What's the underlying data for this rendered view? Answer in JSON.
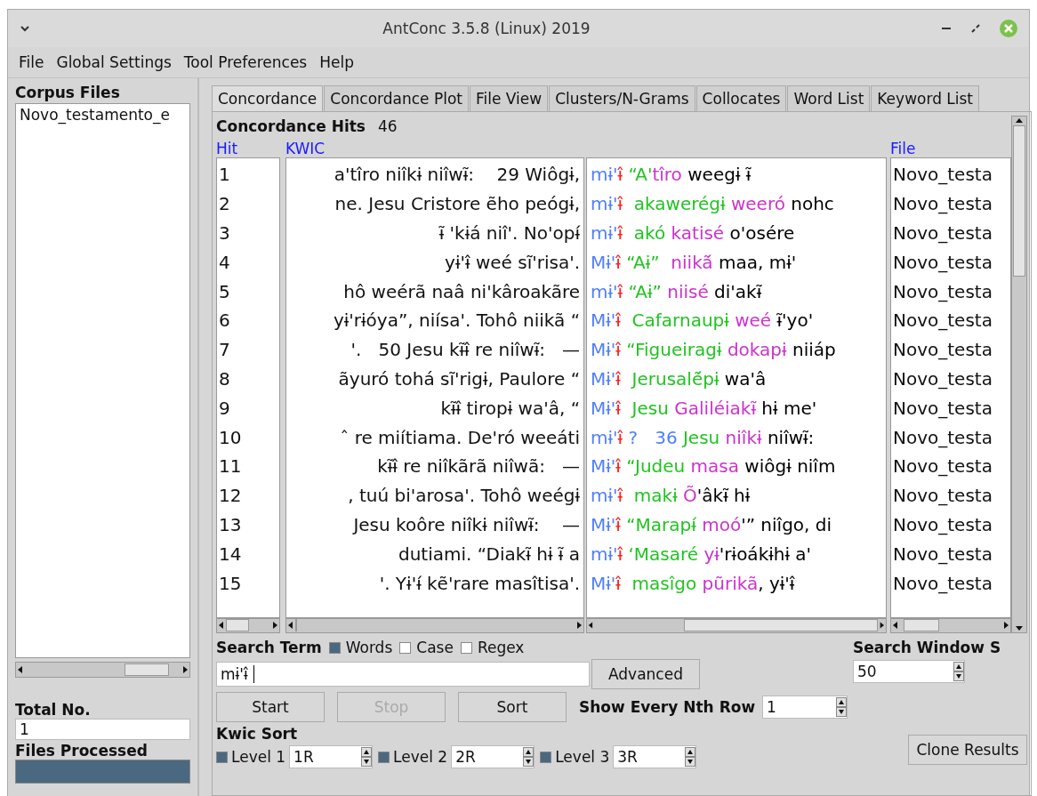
{
  "window": {
    "title": "AntConc 3.5.8 (Linux) 2019"
  },
  "menu": [
    "File",
    "Global Settings",
    "Tool Preferences",
    "Help"
  ],
  "corpus_files": {
    "label": "Corpus Files",
    "files": [
      "Novo_testamento_e"
    ]
  },
  "total_no": {
    "label": "Total No.",
    "value": "1"
  },
  "files_processed": {
    "label": "Files Processed",
    "level": 1
  },
  "tabs": [
    {
      "label": "Concordance",
      "selected": true
    },
    {
      "label": "Concordance Plot",
      "selected": false
    },
    {
      "label": "File View",
      "selected": false
    },
    {
      "label": "Clusters/N-Grams",
      "selected": false
    },
    {
      "label": "Collocates",
      "selected": false
    },
    {
      "label": "Word List",
      "selected": false
    },
    {
      "label": "Keyword List",
      "selected": false
    }
  ],
  "hits": {
    "label": "Concordance Hits",
    "value": "46"
  },
  "table": {
    "columns": [
      "Hit",
      "KWIC",
      "File"
    ],
    "rows": [
      {
        "hit": "1",
        "left": "a'tîro niîkɨ niîwɨ̃:    29 Wiôgɨ,",
        "right": [
          {
            "text": "mɨ'",
            "color": "#4f7fff"
          },
          {
            "text": "ɨ̂ ",
            "color": "#ff2020"
          },
          {
            "text": "“A'",
            "color": "#22c322"
          },
          {
            "text": "tîro",
            "color": "#cc33cc"
          },
          {
            "text": " weegɨ ɨ̃",
            "color": "#000000"
          }
        ],
        "file": "Novo_testa"
      },
      {
        "hit": "2",
        "left": "ne. Jesu Cristore ẽho peógɨ,",
        "right": [
          {
            "text": "mɨ'",
            "color": "#4f7fff"
          },
          {
            "text": "ɨ̂  ",
            "color": "#ff2020"
          },
          {
            "text": "akawerégɨ",
            "color": "#22c322"
          },
          {
            "text": " weeró",
            "color": "#cc33cc"
          },
          {
            "text": " nohc",
            "color": "#000000"
          }
        ],
        "file": "Novo_testa"
      },
      {
        "hit": "3",
        "left": "ɨ̃ 'kɨá niî'. No'opɨ́",
        "right": [
          {
            "text": "mɨ'",
            "color": "#4f7fff"
          },
          {
            "text": "ɨ̂  ",
            "color": "#ff2020"
          },
          {
            "text": "akó",
            "color": "#22c322"
          },
          {
            "text": " katisé",
            "color": "#cc33cc"
          },
          {
            "text": " o'osére",
            "color": "#000000"
          }
        ],
        "file": "Novo_testa"
      },
      {
        "hit": "4",
        "left": "yɨ'ɨ̂ weé sĩ'risa'.",
        "right": [
          {
            "text": "Mɨ'",
            "color": "#4f7fff"
          },
          {
            "text": "ɨ̂ ",
            "color": "#ff2020"
          },
          {
            "text": "“Aɨ”",
            "color": "#22c322"
          },
          {
            "text": "  niikã́",
            "color": "#cc33cc"
          },
          {
            "text": " maa, mɨ'",
            "color": "#000000"
          }
        ],
        "file": "Novo_testa"
      },
      {
        "hit": "5",
        "left": "hô weérã naâ ni'kâroakãre",
        "right": [
          {
            "text": "mɨ'",
            "color": "#4f7fff"
          },
          {
            "text": "ɨ̂ ",
            "color": "#ff2020"
          },
          {
            "text": "“Aɨ”",
            "color": "#22c322"
          },
          {
            "text": " niisé",
            "color": "#cc33cc"
          },
          {
            "text": " di'akɨ̃",
            "color": "#000000"
          }
        ],
        "file": "Novo_testa"
      },
      {
        "hit": "6",
        "left": "yɨ'rɨóya”, niísa'. Tohô niikã “",
        "right": [
          {
            "text": "Mɨ'",
            "color": "#4f7fff"
          },
          {
            "text": "ɨ̂  ",
            "color": "#ff2020"
          },
          {
            "text": "Cafarnaupɨ",
            "color": "#22c322"
          },
          {
            "text": " weé",
            "color": "#cc33cc"
          },
          {
            "text": " ɨ̃'yo'",
            "color": "#000000"
          }
        ],
        "file": "Novo_testa"
      },
      {
        "hit": "7",
        "left": "'.   50 Jesu kɨ̃ɨ̂ re niîwɨ̃:   —",
        "right": [
          {
            "text": "Mɨ'",
            "color": "#4f7fff"
          },
          {
            "text": "ɨ̂ ",
            "color": "#ff2020"
          },
          {
            "text": "“Figueiragɨ",
            "color": "#22c322"
          },
          {
            "text": " dokapɨ",
            "color": "#cc33cc"
          },
          {
            "text": " niiáp",
            "color": "#000000"
          }
        ],
        "file": "Novo_testa"
      },
      {
        "hit": "8",
        "left": "ãyuró tohá sĩ'rigɨ, Paulore “",
        "right": [
          {
            "text": "Mɨ'",
            "color": "#4f7fff"
          },
          {
            "text": "ɨ̂  ",
            "color": "#ff2020"
          },
          {
            "text": "Jerusalẽ́pɨ",
            "color": "#22c322"
          },
          {
            "text": " wa'â",
            "color": "#000000"
          }
        ],
        "file": "Novo_testa"
      },
      {
        "hit": "9",
        "left": "kɨ̃ɨ̂ tiropɨ wa'â, “",
        "right": [
          {
            "text": "Mɨ'",
            "color": "#4f7fff"
          },
          {
            "text": "ɨ̂  ",
            "color": "#ff2020"
          },
          {
            "text": "Jesu",
            "color": "#22c322"
          },
          {
            "text": " Galiléiakɨ̃",
            "color": "#cc33cc"
          },
          {
            "text": " hɨ me'",
            "color": "#000000"
          }
        ],
        "file": "Novo_testa"
      },
      {
        "hit": "10",
        "left": "ˆ re miítiama. De'ró weeáti",
        "right": [
          {
            "text": "mɨ'",
            "color": "#4f7fff"
          },
          {
            "text": "ɨ̂ ",
            "color": "#ff2020"
          },
          {
            "text": "?   36",
            "color": "#4f7fff"
          },
          {
            "text": " Jesu",
            "color": "#22c322"
          },
          {
            "text": " niîkɨ",
            "color": "#cc33cc"
          },
          {
            "text": " niîwɨ̃:",
            "color": "#000000"
          }
        ],
        "file": "Novo_testa"
      },
      {
        "hit": "11",
        "left": "kɨ̃ɨ̂ re niîkãrã niîwã:   —",
        "right": [
          {
            "text": "Mɨ'",
            "color": "#4f7fff"
          },
          {
            "text": "ɨ̂ ",
            "color": "#ff2020"
          },
          {
            "text": "“Judeu",
            "color": "#22c322"
          },
          {
            "text": " masa",
            "color": "#cc33cc"
          },
          {
            "text": " wiôgɨ niîm",
            "color": "#000000"
          }
        ],
        "file": "Novo_testa"
      },
      {
        "hit": "12",
        "left": ", tuú bi'arosa'. Tohô weégɨ",
        "right": [
          {
            "text": "mɨ'",
            "color": "#4f7fff"
          },
          {
            "text": "ɨ̂  ",
            "color": "#ff2020"
          },
          {
            "text": "makɨ",
            "color": "#22c322"
          },
          {
            "text": " Õ",
            "color": "#cc33cc"
          },
          {
            "text": "'âkɨ̃ hɨ",
            "color": "#000000"
          }
        ],
        "file": "Novo_testa"
      },
      {
        "hit": "13",
        "left": "Jesu koôre niîkɨ niîwɨ̃:    —",
        "right": [
          {
            "text": "Mɨ'",
            "color": "#4f7fff"
          },
          {
            "text": "ɨ̂ ",
            "color": "#ff2020"
          },
          {
            "text": "“Marapɨ́",
            "color": "#22c322"
          },
          {
            "text": " moó",
            "color": "#cc33cc"
          },
          {
            "text": "'” niîgo, di",
            "color": "#000000"
          }
        ],
        "file": "Novo_testa"
      },
      {
        "hit": "14",
        "left": "dutiami. “Diakɨ̃ hɨ ɨ̃ a",
        "right": [
          {
            "text": "mɨ'",
            "color": "#4f7fff"
          },
          {
            "text": "ɨ̂ ",
            "color": "#ff2020"
          },
          {
            "text": "‘Masaré",
            "color": "#22c322"
          },
          {
            "text": " yɨ",
            "color": "#cc33cc"
          },
          {
            "text": "'rɨoákɨhɨ a'",
            "color": "#000000"
          }
        ],
        "file": "Novo_testa"
      },
      {
        "hit": "15",
        "left": "'. Yɨ'ɨ́ kẽ'rare masîtisa'.",
        "right": [
          {
            "text": "Mɨ'",
            "color": "#4f7fff"
          },
          {
            "text": "ɨ̂  ",
            "color": "#ff2020"
          },
          {
            "text": "masîgo",
            "color": "#22c322"
          },
          {
            "text": " pũrikã",
            "color": "#cc33cc"
          },
          {
            "text": ", yɨ'ɨ̂",
            "color": "#000000"
          }
        ],
        "file": "Novo_testa"
      }
    ]
  },
  "search": {
    "label": "Search Term",
    "options": [
      {
        "label": "Words",
        "checked": true
      },
      {
        "label": "Case",
        "checked": false
      },
      {
        "label": "Regex",
        "checked": false
      }
    ],
    "value": "mɨ'ɨ̂",
    "advanced": "Advanced"
  },
  "search_window": {
    "label": "Search Window S",
    "value": "50"
  },
  "buttons": [
    {
      "label": "Start",
      "disabled": false
    },
    {
      "label": "Stop",
      "disabled": true
    },
    {
      "label": "Sort",
      "disabled": false
    }
  ],
  "nth_row": {
    "label": "Show Every Nth Row",
    "value": "1"
  },
  "kwic_sort": {
    "label": "Kwic Sort",
    "levels": [
      {
        "label": "Level 1",
        "checked": true,
        "value": "1R"
      },
      {
        "label": "Level 2",
        "checked": true,
        "value": "2R"
      },
      {
        "label": "Level 3",
        "checked": true,
        "value": "3R"
      }
    ]
  },
  "clone_button": "Clone Results"
}
